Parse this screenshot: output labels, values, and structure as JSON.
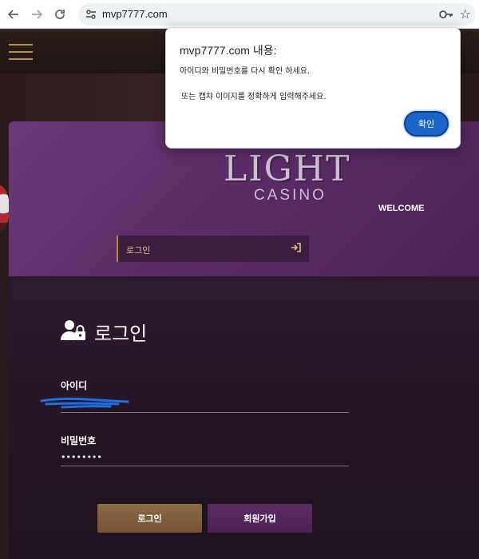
{
  "browser": {
    "url": "mvp7777.com",
    "back_icon": "arrow-left-icon",
    "forward_icon": "arrow-right-icon",
    "reload_icon": "reload-icon"
  },
  "site": {
    "logo": {
      "line1": "LIGHT",
      "line2": "CASINO"
    },
    "welcome": "WELCOME",
    "top_login_label": "로그인"
  },
  "form": {
    "title": "로그인",
    "id_label": "아이디",
    "password_label": "비밀번호",
    "password_value": "••••••••",
    "login_button": "로그인",
    "signup_button": "회원가입"
  },
  "dialog": {
    "title": "mvp7777.com 내용:",
    "line1": "아이디와 비밀번호를 다시 확인 하세요.",
    "line2": "또는 캡챠 이미지를 정확하게 입력해주세요.",
    "ok_button": "확인"
  },
  "colors": {
    "panel_purple": "#5a2d66",
    "gold": "#b6924f",
    "dialog_button": "#1a66c8"
  }
}
